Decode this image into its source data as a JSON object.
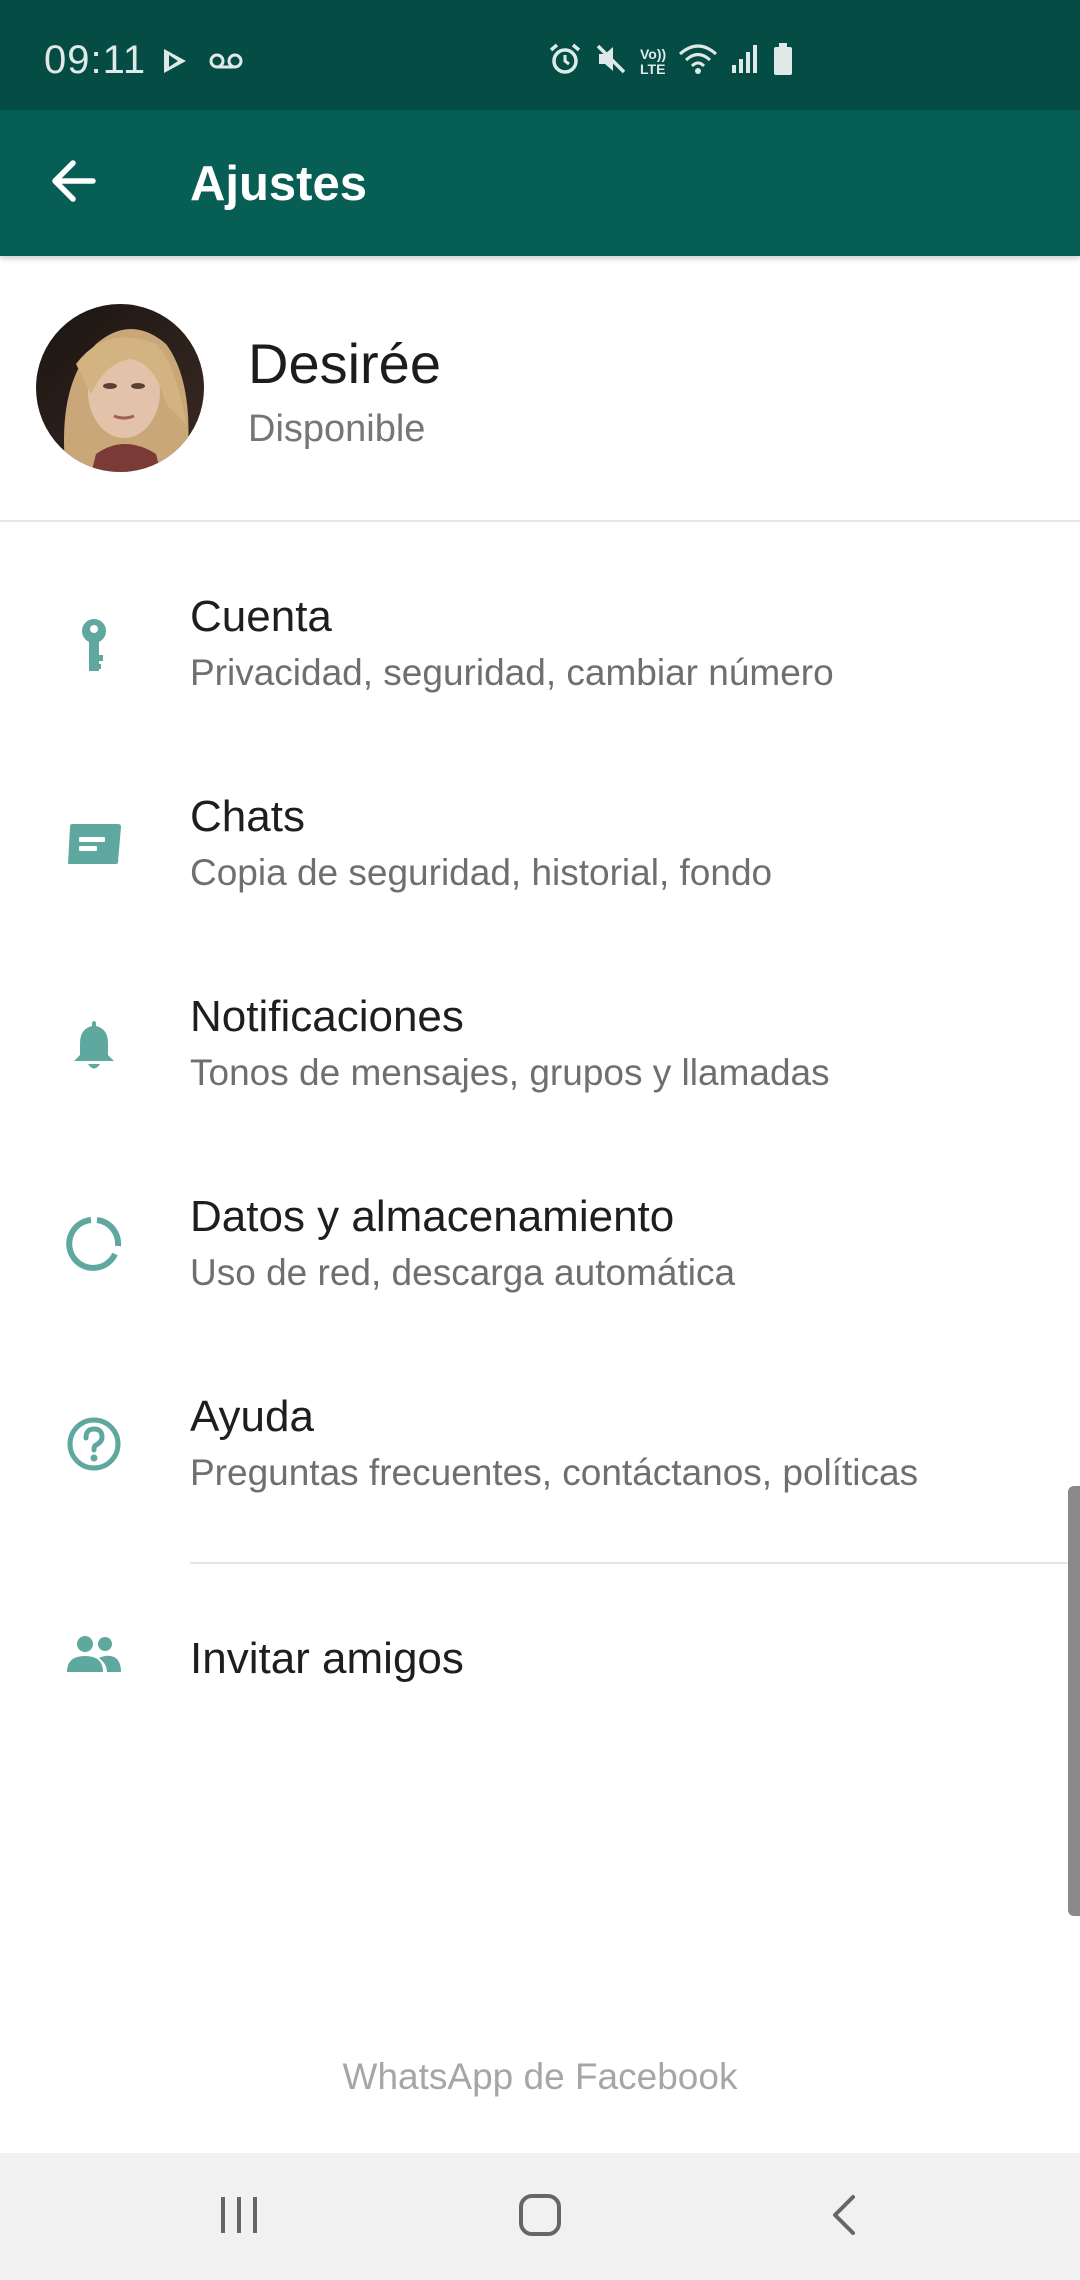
{
  "status_bar": {
    "time": "09:11",
    "left_icons": [
      "play-store-icon",
      "voicemail-icon"
    ],
    "right_icons": [
      "alarm-icon",
      "mute-icon",
      "volte-icon",
      "wifi-icon",
      "signal-icon",
      "battery-icon"
    ],
    "volte_label_top": "Vo))",
    "volte_label_bottom": "LTE"
  },
  "app_bar": {
    "title": "Ajustes",
    "background": "#075e54"
  },
  "profile": {
    "name": "Desirée",
    "status": "Disponible"
  },
  "settings": [
    {
      "title": "Cuenta",
      "subtitle": "Privacidad, seguridad, cambiar número",
      "icon": "key-icon"
    },
    {
      "title": "Chats",
      "subtitle": "Copia de seguridad, historial, fondo",
      "icon": "chat-icon"
    },
    {
      "title": "Notificaciones",
      "subtitle": "Tonos de mensajes, grupos y llamadas",
      "icon": "bell-icon"
    },
    {
      "title": "Datos y almacenamiento",
      "subtitle": "Uso de red, descarga automática",
      "icon": "data-usage-icon"
    },
    {
      "title": "Ayuda",
      "subtitle": "Preguntas frecuentes, contáctanos, políticas",
      "icon": "help-icon"
    }
  ],
  "invite": {
    "title": "Invitar amigos",
    "icon": "people-icon"
  },
  "footer": {
    "text": "WhatsApp de Facebook"
  },
  "nav_bar": {
    "buttons": [
      "recent-apps-icon",
      "home-icon",
      "back-icon"
    ]
  },
  "colors": {
    "accent_icon": "#5fa89f",
    "status_bar": "#054d44"
  }
}
